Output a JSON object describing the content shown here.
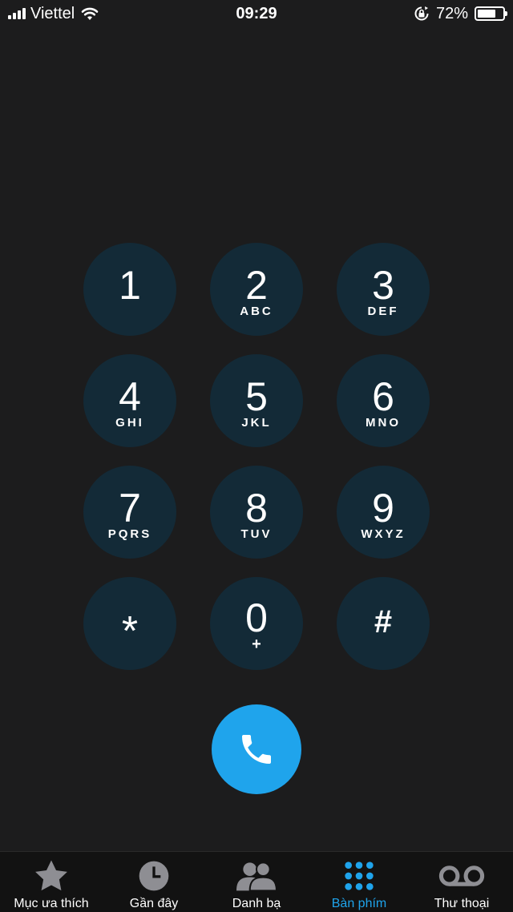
{
  "status_bar": {
    "carrier": "Viettel",
    "time": "09:29",
    "battery_percent": "72%",
    "battery_level": 0.72,
    "icons": [
      "signal-bars-icon",
      "wifi-icon",
      "orientation-lock-icon",
      "battery-icon"
    ]
  },
  "keypad": {
    "keys": [
      {
        "digit": "1",
        "letters": ""
      },
      {
        "digit": "2",
        "letters": "ABC"
      },
      {
        "digit": "3",
        "letters": "DEF"
      },
      {
        "digit": "4",
        "letters": "GHI"
      },
      {
        "digit": "5",
        "letters": "JKL"
      },
      {
        "digit": "6",
        "letters": "MNO"
      },
      {
        "digit": "7",
        "letters": "PQRS"
      },
      {
        "digit": "8",
        "letters": "TUV"
      },
      {
        "digit": "9",
        "letters": "WXYZ"
      },
      {
        "digit": "*",
        "letters": ""
      },
      {
        "digit": "0",
        "letters": "+"
      },
      {
        "digit": "#",
        "letters": ""
      }
    ],
    "call_icon": "phone-icon"
  },
  "tab_bar": {
    "tabs": [
      {
        "label": "Mục ưa thích",
        "icon": "star-icon",
        "active": false
      },
      {
        "label": "Gần đây",
        "icon": "clock-icon",
        "active": false
      },
      {
        "label": "Danh bạ",
        "icon": "contacts-icon",
        "active": false
      },
      {
        "label": "Bàn phím",
        "icon": "keypad-icon",
        "active": true
      },
      {
        "label": "Thư thoại",
        "icon": "voicemail-icon",
        "active": false
      }
    ]
  },
  "colors": {
    "background": "#1c1c1d",
    "key_background": "#132a37",
    "accent": "#1fa4ec",
    "tab_bar_background": "#121212",
    "inactive_icon": "#8e8e93"
  }
}
